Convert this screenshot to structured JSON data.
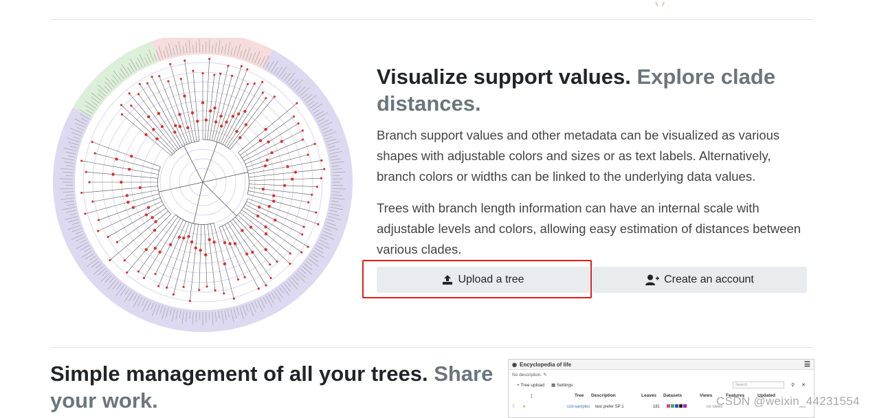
{
  "feature": {
    "heading_main": "Visualize support values.",
    "heading_muted": "Explore clade distances.",
    "paragraph1": "Branch support values and other metadata can be visualized as various shapes with adjustable colors and sizes or as text labels. Alternatively, branch colors or widths can be linked to the underlying data values.",
    "paragraph2": "Trees with branch length information can have an internal scale with adjustable levels and colors, allowing easy estimation of distances between various clades."
  },
  "buttons": {
    "upload_label": "Upload a tree",
    "upload_icon": "upload-icon",
    "account_label": "Create an account",
    "account_icon": "add-user-icon"
  },
  "section2": {
    "heading_main": "Simple management of all your trees.",
    "heading_muted": "Share your work."
  },
  "mini_screenshot": {
    "title": "Encyclopedia of life",
    "description": "No description.",
    "tree_upload": "Tree upload",
    "settings": "Settings",
    "search_placeholder": "Search",
    "columns": [
      "Tree",
      "Description",
      "Leaves",
      "Datasets",
      "Views",
      "Features",
      "Updated"
    ],
    "row": {
      "tree": "coli-samples",
      "description": "test prefer SP 1",
      "leaves": "181",
      "views": "no views"
    }
  },
  "colors": {
    "accent_highlight": "#e31b1b",
    "button_bg": "#e9ecef",
    "muted_text": "#6c757d",
    "ring_purple": "#dcd9f0",
    "ring_pink": "#f6dcdc",
    "ring_green": "#dcefd8"
  },
  "watermark": "CSDN @weixin_44231554"
}
